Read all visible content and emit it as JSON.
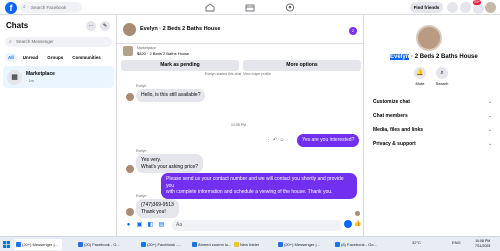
{
  "topbar": {
    "search_placeholder": "Search Facebook",
    "find_friends": "Find friends",
    "notif_count": "20+"
  },
  "sidebar": {
    "title": "Chats",
    "search_placeholder": "Search Messenger",
    "filters": [
      "All",
      "Unread",
      "Groups",
      "Communities"
    ],
    "chat": {
      "name": "Marketplace",
      "sub": "· 1m"
    }
  },
  "conversation": {
    "title": "Evelyn · 2 Beds 2 Baths House",
    "badge": "2",
    "marketplace_label": "Marketplace",
    "listing": "$820 · 2 Beds 2 Baths House",
    "mark_pending": "Mark as pending",
    "more_options": "More options",
    "system_note": "Evelyn started this chat. View buyer profile",
    "time_divider": "10:08 PM",
    "messages": [
      {
        "sender": "Evelyn",
        "text": "Hello, is this still available?"
      },
      {
        "text": "Yes are you interested?"
      },
      {
        "sender": "Evelyn",
        "line1": "Yes very.",
        "line2": "What's your asking price?"
      },
      {
        "line1": "Please send us your contact number and we will contact you shortly and provide you",
        "line2": "with complete information and schedule a viewing of the house. Thank you."
      },
      {
        "sender": "Evelyn",
        "line1": "(747)369-9513",
        "line2": "Thank you!"
      }
    ],
    "composer_placeholder": "Aa"
  },
  "right_panel": {
    "name_highlight": "Evelyn",
    "name_rest": " · 2 Beds 2 Baths House",
    "mute": "Mute",
    "search": "Search",
    "menu": [
      "Customize chat",
      "Chat members",
      "Media, files and links",
      "Privacy & support"
    ]
  },
  "taskbar": {
    "items": [
      "(20+) Messenger |...",
      "(20) Facebook - G...",
      "(20+) Facebook -...",
      "Ahmed zoomn lo...",
      "New folder",
      "(20+) Messenger |...",
      "(8) Facebook - Go..."
    ],
    "weather": "32°C",
    "lang": "ENG",
    "time": "10:08 PM",
    "date": "7/11/2025"
  },
  "colors": {
    "accent": "#0866ff",
    "bubble_out": "#7130f0",
    "bubble_in": "#e4e6eb"
  }
}
